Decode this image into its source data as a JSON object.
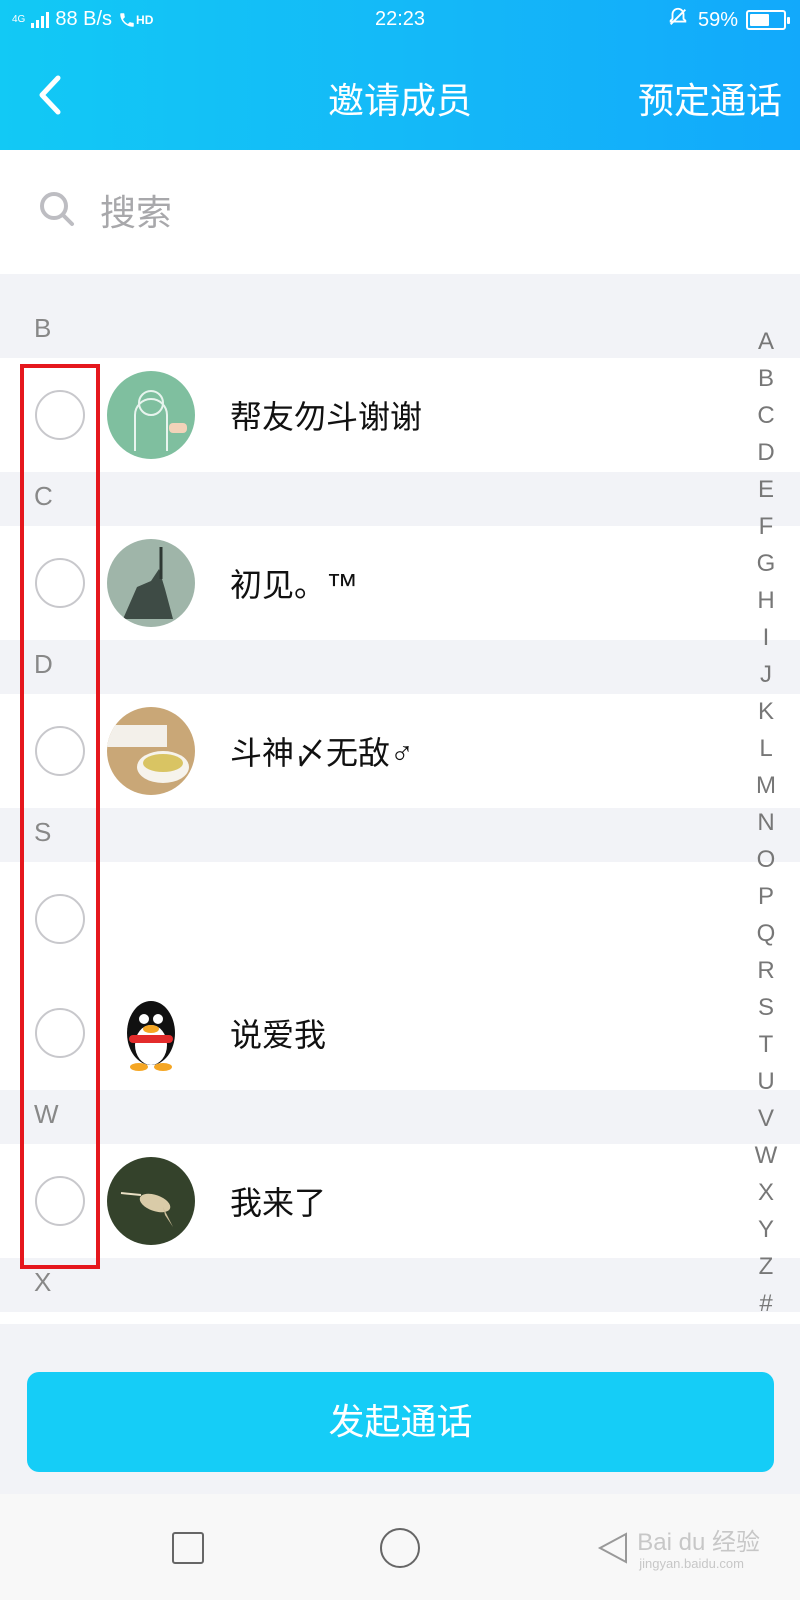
{
  "status_bar": {
    "network": "4G",
    "speed": "88 B/s",
    "hd": "HD",
    "time": "22:23",
    "battery": "59%",
    "battery_level": 0.59
  },
  "header": {
    "title": "邀请成员",
    "action": "预定通话"
  },
  "search": {
    "placeholder": "搜索"
  },
  "list": [
    {
      "letter": "B",
      "items": [
        {
          "name": "帮友勿斗谢谢"
        }
      ]
    },
    {
      "letter": "C",
      "items": [
        {
          "name": "初见。™"
        }
      ]
    },
    {
      "letter": "D",
      "items": [
        {
          "name": "斗神〆无敌♂"
        }
      ]
    },
    {
      "letter": "S",
      "items": [
        {
          "name": ""
        },
        {
          "name": "说爱我"
        }
      ]
    },
    {
      "letter": "W",
      "items": [
        {
          "name": "我来了"
        }
      ]
    },
    {
      "letter": "X",
      "items": []
    }
  ],
  "index_letters": [
    "A",
    "B",
    "C",
    "D",
    "E",
    "F",
    "G",
    "H",
    "I",
    "J",
    "K",
    "L",
    "M",
    "N",
    "O",
    "P",
    "Q",
    "R",
    "S",
    "T",
    "U",
    "V",
    "W",
    "X",
    "Y",
    "Z",
    "#"
  ],
  "call_button": "发起通话",
  "watermark": {
    "brand": "Bai du 经验",
    "url": "jingyan.baidu.com"
  },
  "colors": {
    "header": "#14b8f8",
    "primary_button": "#15cdf7",
    "highlight": "#e5171d"
  }
}
